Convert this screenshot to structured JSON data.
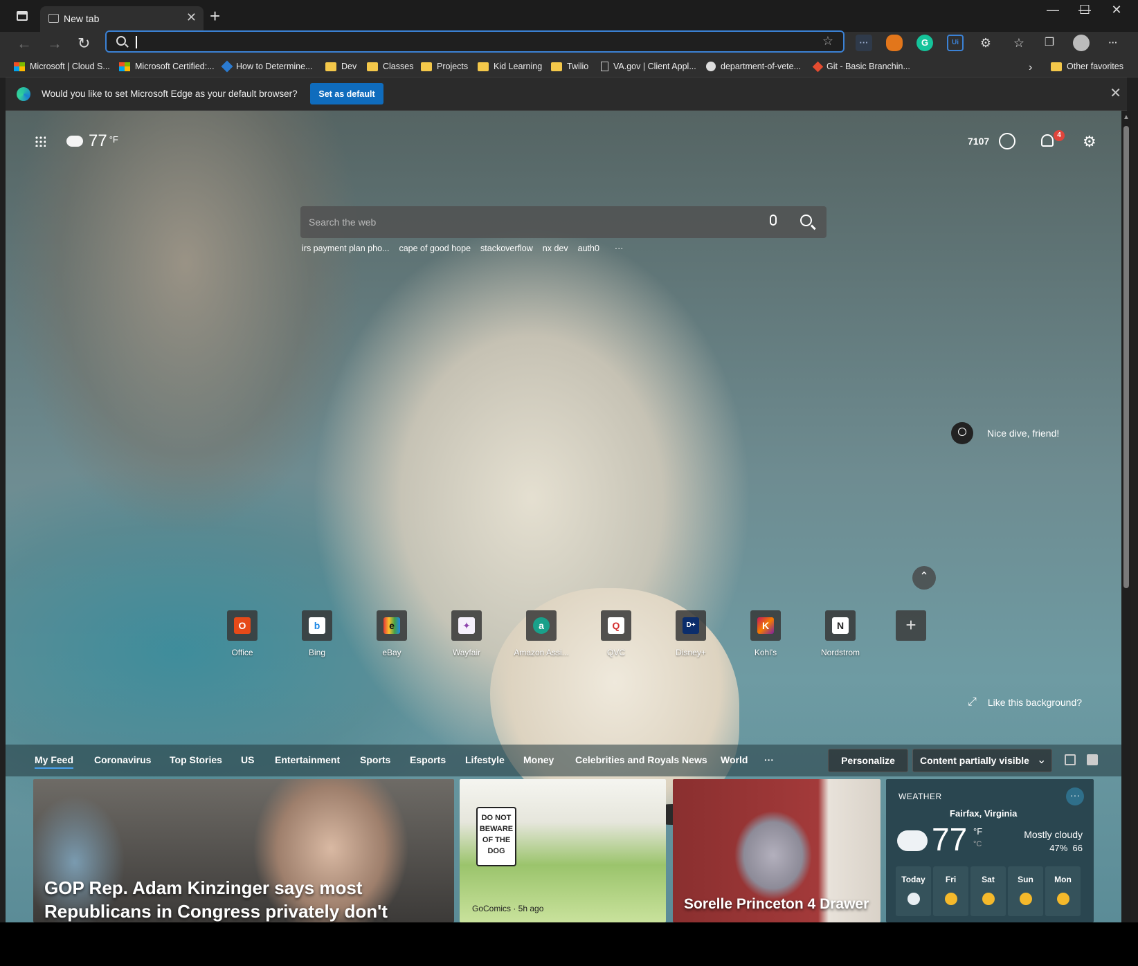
{
  "tab": {
    "title": "New tab",
    "close": "✕"
  },
  "new_tab_symbol": "+",
  "window_controls": {
    "minimize": "—",
    "maximize": "☐",
    "close": "✕"
  },
  "nav": {
    "back": "←",
    "forward": "→",
    "reload": "↻"
  },
  "address_bar": {
    "value": "",
    "placeholder": ""
  },
  "toolbar_icons": [
    "extension-dots",
    "metamask",
    "grammarly",
    "ui-ext",
    "puzzle",
    "favorites",
    "collections",
    "profile",
    "more"
  ],
  "favorites": [
    {
      "label": "Microsoft | Cloud S...",
      "icon": "microsoft-logo"
    },
    {
      "label": "Microsoft Certified:...",
      "icon": "microsoft-logo"
    },
    {
      "label": "How to Determine...",
      "icon": "diamond-logo"
    },
    {
      "label": "Dev",
      "icon": "folder"
    },
    {
      "label": "Classes",
      "icon": "folder"
    },
    {
      "label": "Projects",
      "icon": "folder"
    },
    {
      "label": "Kid Learning",
      "icon": "folder"
    },
    {
      "label": "Twilio",
      "icon": "folder"
    },
    {
      "label": "VA.gov | Client Appl...",
      "icon": "page"
    },
    {
      "label": "department-of-vete...",
      "icon": "github"
    },
    {
      "label": "Git - Basic Branchin...",
      "icon": "git"
    },
    {
      "label": "Other favorites",
      "icon": "folder"
    }
  ],
  "favorites_overflow": "›",
  "infobar": {
    "message": "Would you like to set Microsoft Edge as your default browser?",
    "button": "Set as default",
    "close": "✕"
  },
  "ntp": {
    "weather_temp": "77",
    "weather_unit": "°F",
    "rewards_points": "7107",
    "notifications_count": "4",
    "settings_icon": "⚙",
    "search_placeholder": "Search the web",
    "trending": [
      "irs payment plan pho...",
      "cape of good hope",
      "stackoverflow",
      "nx dev",
      "auth0",
      "···"
    ],
    "image_caption": "Nice dive, friend!",
    "collapse": "⌃",
    "tiles": [
      {
        "label": "Office",
        "glyph": "O",
        "color": "#e64a19"
      },
      {
        "label": "Bing",
        "glyph": "b",
        "color": "#1e88e5"
      },
      {
        "label": "eBay",
        "glyph": "e",
        "color": "#e53935"
      },
      {
        "label": "Wayfair",
        "glyph": "✦",
        "color": "#8e44ad"
      },
      {
        "label": "Amazon Assi...",
        "glyph": "a",
        "color": "#19a08a"
      },
      {
        "label": "QVC",
        "glyph": "Q",
        "color": "#d32f2f"
      },
      {
        "label": "Disney+",
        "glyph": "D+",
        "color": "#0b2d6b"
      },
      {
        "label": "Kohl's",
        "glyph": "K",
        "color": "#c2185b"
      },
      {
        "label": "Nordstrom",
        "glyph": "N",
        "color": "#222222"
      }
    ],
    "add_tile": "+",
    "like_background": "Like this background?",
    "like_arrow": "⤢"
  },
  "feed_nav": {
    "items": [
      "My Feed",
      "Coronavirus",
      "Top Stories",
      "US",
      "Entertainment",
      "Sports",
      "Esports",
      "Lifestyle",
      "Money",
      "Celebrities and Royals News",
      "World",
      "···"
    ],
    "personalize": "Personalize",
    "content_visibility": "Content partially visible",
    "chevron": "⌄"
  },
  "cards": {
    "news1_headline": "GOP Rep. Adam Kinzinger says most Republicans in Congress privately don't",
    "comic_sign": "DO NOT BEWARE OF THE DOG",
    "comic_source": "GoComics · 5h ago",
    "product_headline": "Sorelle Princeton 4 Drawer"
  },
  "weather_card": {
    "title": "WEATHER",
    "more": "···",
    "location": "Fairfax, Virginia",
    "temp": "77",
    "unit_f": "°F",
    "unit_c": "°C",
    "condition": "Mostly cloudy",
    "humidity": "47%",
    "wind": "66",
    "days": [
      "Today",
      "Fri",
      "Sat",
      "Sun",
      "Mon"
    ]
  }
}
